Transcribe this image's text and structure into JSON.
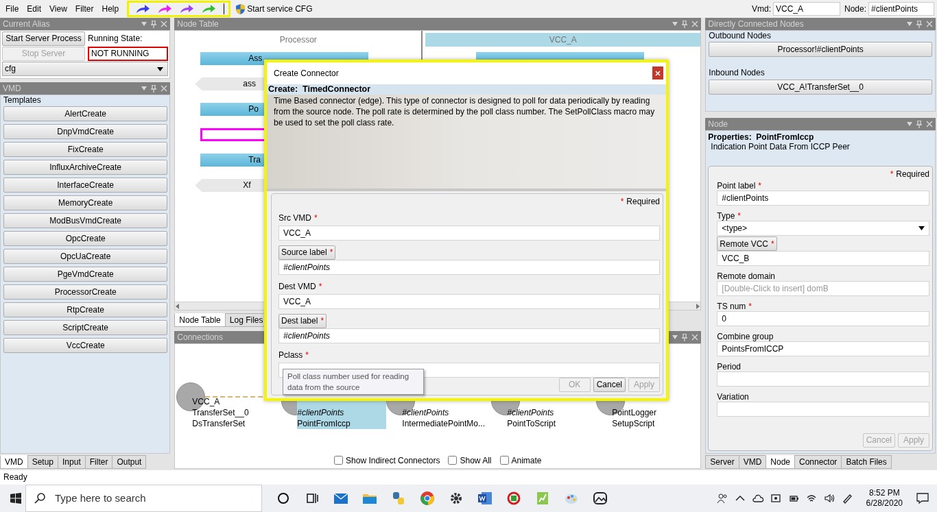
{
  "menu": [
    "File",
    "Edit",
    "View",
    "Filter",
    "Help"
  ],
  "toolbar": {
    "arrows": [
      {
        "color": "#3b3bf0"
      },
      {
        "color": "#f020f0"
      },
      {
        "color": "#a040f0"
      },
      {
        "color": "#30c030"
      }
    ],
    "service_button": "Start service CFG"
  },
  "vmd_field": {
    "label": "Vmd:",
    "value": "VCC_A"
  },
  "node_field": {
    "label": "Node:",
    "value": "#clientPoints"
  },
  "alias_panel": {
    "title": "Current Alias",
    "start_button": "Start Server Process",
    "running_label": "Running State:",
    "stop_button": {
      "label": "Stop Server",
      "disabled": true
    },
    "state": "NOT RUNNING",
    "alias": "cfg"
  },
  "vmd_panel": {
    "title": "VMD",
    "section": "Templates",
    "templates": [
      "AlertCreate",
      "DnpVmdCreate",
      "FixCreate",
      "InfluxArchiveCreate",
      "InterfaceCreate",
      "MemoryCreate",
      "ModBusVmdCreate",
      "OpcCreate",
      "OpcUaCreate",
      "PgeVmdCreate",
      "ProcessorCreate",
      "RtpCreate",
      "ScriptCreate",
      "VccCreate"
    ]
  },
  "left_tabs": [
    {
      "label": "VMD",
      "selected": true
    },
    {
      "label": "Setup",
      "selected": false
    },
    {
      "label": "Input",
      "selected": false
    },
    {
      "label": "Filter",
      "selected": false
    },
    {
      "label": "Output",
      "selected": false
    }
  ],
  "node_table": {
    "title": "Node Table",
    "columns": [
      {
        "header": "Processor",
        "highlighted": false,
        "items": [
          {
            "kind": "bar",
            "text": "Ass",
            "selected": false
          },
          {
            "kind": "tag",
            "text": "ass",
            "selected": false
          },
          {
            "kind": "bar",
            "text": "Po",
            "selected": false
          },
          {
            "kind": "tag",
            "selected": true
          },
          {
            "kind": "bar",
            "text": "Tra",
            "selected": false
          },
          {
            "kind": "tag",
            "text": "Xf",
            "selected": false
          }
        ]
      },
      {
        "header": "VCC_A",
        "highlighted": true,
        "items": [
          {
            "kind": "bar",
            "selected": false
          }
        ]
      }
    ]
  },
  "center_tabs": [
    {
      "label": "Node Table",
      "selected": true
    },
    {
      "label": "Log Files",
      "selected": false
    }
  ],
  "connections": {
    "title": "Connections",
    "nodes": [
      {
        "vmd": "VCC_A",
        "point": "TransferSet__0",
        "italic": false,
        "type": "DsTransferSet",
        "selected": false
      },
      {
        "point": "#clientPoints",
        "italic": true,
        "type": "PointFromIccp",
        "selected": true
      },
      {
        "point": "#clientPoints",
        "italic": true,
        "type": "IntermediatePointMo...",
        "selected": false
      },
      {
        "point": "#clientPoints",
        "italic": true,
        "type": "PointToScript",
        "selected": false
      },
      {
        "point": "PointLogger",
        "italic": false,
        "type": "SetupScript",
        "selected": false
      }
    ],
    "options": [
      {
        "label": "Show Indirect Connectors",
        "checked": false
      },
      {
        "label": "Show All",
        "checked": false
      },
      {
        "label": "Animate",
        "checked": false
      }
    ]
  },
  "dialog": {
    "title": "Create Connector",
    "heading_prefix": "Create:",
    "heading": "TimedConnector",
    "description": "Time Based connector (edge). This type of connector is designed to poll for data periodically by reading from the source node. The poll rate is determined by the poll class number. The SetPollClass macro may be used to set the poll class rate.",
    "required_marker": "*",
    "required_note": "Required",
    "fields": [
      {
        "label": "Src VMD",
        "label_button": false,
        "required": true,
        "value": "VCC_A",
        "italic": false
      },
      {
        "label": "Source label",
        "label_button": true,
        "required": true,
        "value": "#clientPoints",
        "italic": true
      },
      {
        "label": "Dest VMD",
        "label_button": false,
        "required": true,
        "value": "VCC_A",
        "italic": false
      },
      {
        "label": "Dest label",
        "label_button": true,
        "required": true,
        "value": "#clientPoints",
        "italic": true
      },
      {
        "label": "Pclass",
        "label_button": false,
        "required": true
      }
    ],
    "buttons": [
      {
        "label": "OK",
        "disabled": true
      },
      {
        "label": "Cancel",
        "disabled": false
      },
      {
        "label": "Apply",
        "disabled": true
      }
    ],
    "tooltip": "Poll class number used for reading data from the source"
  },
  "connected_nodes": {
    "title": "Directly Connected Nodes",
    "outbound_label": "Outbound Nodes",
    "outbound": [
      "Processor!#clientPoints"
    ],
    "inbound_label": "Inbound Nodes",
    "inbound": [
      "VCC_A!TransferSet__0"
    ]
  },
  "node_panel": {
    "title": "Node",
    "heading_prefix": "Properties:",
    "heading": "PointFromIccp",
    "description": "Indication Point Data From ICCP Peer",
    "required_marker": "*",
    "required_note": "Required",
    "fields": [
      {
        "label": "Point label",
        "label_button": false,
        "required": true,
        "kind": "text",
        "value": "#clientPoints"
      },
      {
        "label": "Type",
        "label_button": false,
        "required": true,
        "kind": "select",
        "value": "<type>"
      },
      {
        "label": "Remote VCC",
        "label_button": true,
        "required": true,
        "kind": "text",
        "value": "VCC_B"
      },
      {
        "label": "Remote domain",
        "label_button": false,
        "required": false,
        "kind": "text",
        "placeholder": "[Double-Click to insert] domB"
      },
      {
        "label": "TS num",
        "label_button": false,
        "required": true,
        "kind": "text",
        "value": "0"
      },
      {
        "label": "Combine group",
        "label_button": false,
        "required": false,
        "kind": "text",
        "value": "PointsFromICCP"
      },
      {
        "label": "Period",
        "label_button": false,
        "required": false,
        "kind": "text"
      },
      {
        "label": "Variation",
        "label_button": false,
        "required": false,
        "kind": "text"
      }
    ],
    "buttons": [
      {
        "label": "Cancel",
        "disabled": true
      },
      {
        "label": "Apply",
        "disabled": true
      }
    ]
  },
  "right_tabs": [
    {
      "label": "Server",
      "selected": false
    },
    {
      "label": "VMD",
      "selected": false
    },
    {
      "label": "Node",
      "selected": true
    },
    {
      "label": "Connector",
      "selected": false
    },
    {
      "label": "Batch Files",
      "selected": false
    }
  ],
  "status_bar": "Ready",
  "taskbar": {
    "search_placeholder": "Type here to search",
    "time": "8:52 PM",
    "date": "6/28/2020"
  }
}
